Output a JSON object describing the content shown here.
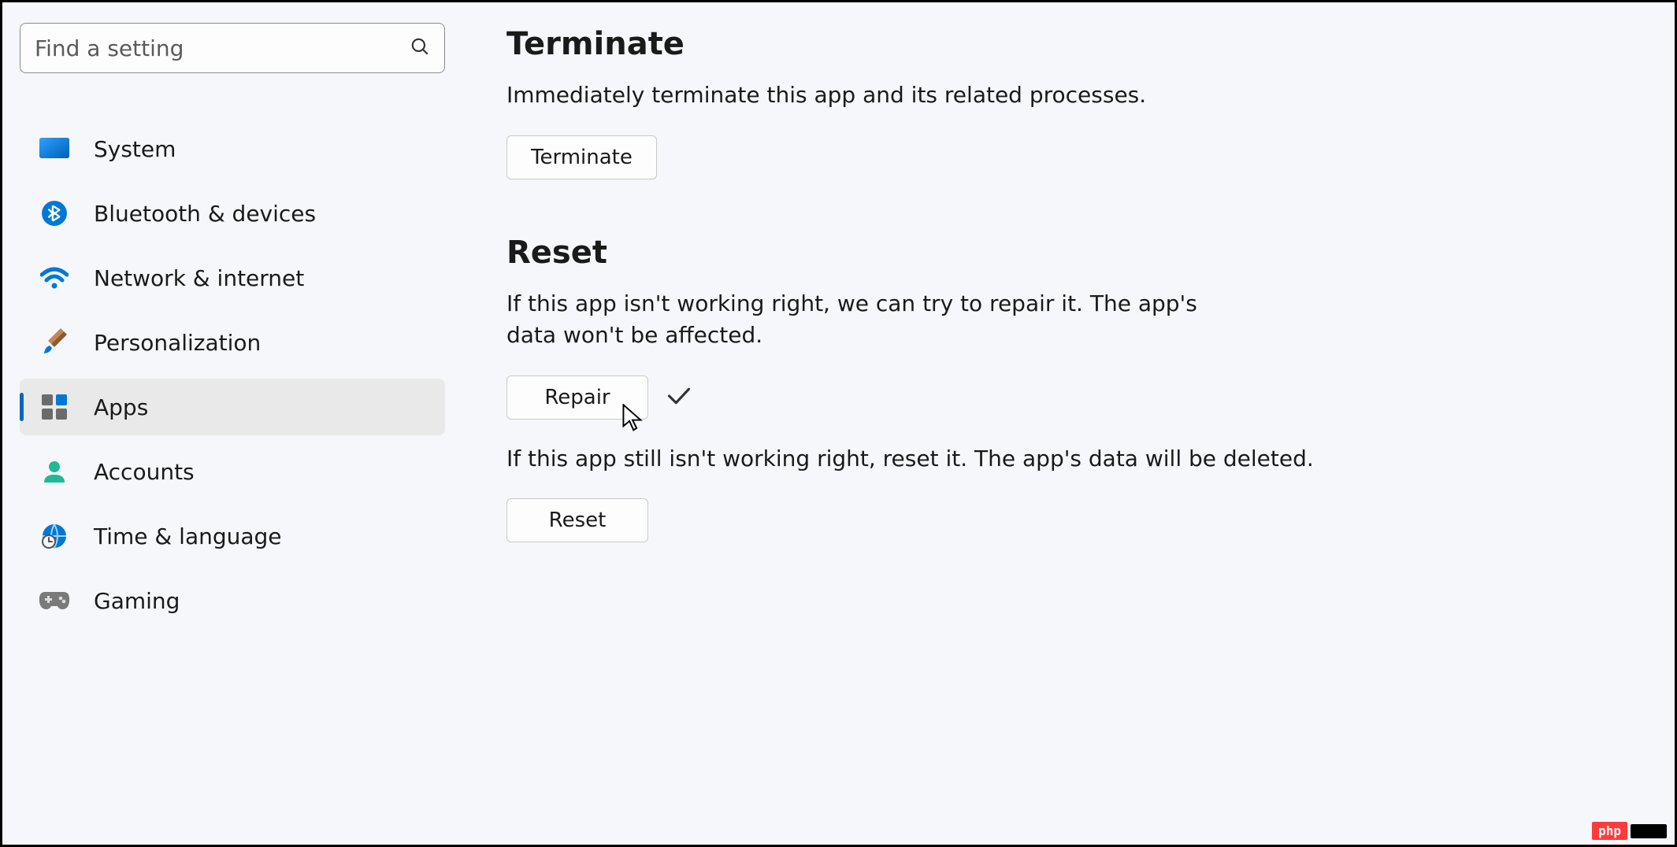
{
  "search": {
    "placeholder": "Find a setting"
  },
  "sidebar": {
    "items": [
      {
        "id": "system",
        "label": "System",
        "icon": "monitor-icon",
        "selected": false
      },
      {
        "id": "bluetooth",
        "label": "Bluetooth & devices",
        "icon": "bluetooth-icon",
        "selected": false
      },
      {
        "id": "network",
        "label": "Network & internet",
        "icon": "wifi-icon",
        "selected": false
      },
      {
        "id": "personalization",
        "label": "Personalization",
        "icon": "brush-icon",
        "selected": false
      },
      {
        "id": "apps",
        "label": "Apps",
        "icon": "apps-icon",
        "selected": true
      },
      {
        "id": "accounts",
        "label": "Accounts",
        "icon": "person-icon",
        "selected": false
      },
      {
        "id": "time",
        "label": "Time & language",
        "icon": "globe-icon",
        "selected": false
      },
      {
        "id": "gaming",
        "label": "Gaming",
        "icon": "gamepad-icon",
        "selected": false
      }
    ]
  },
  "content": {
    "terminate": {
      "heading": "Terminate",
      "description": "Immediately terminate this app and its related processes.",
      "button": "Terminate"
    },
    "reset": {
      "heading": "Reset",
      "repair_description": "If this app isn't working right, we can try to repair it. The app's data won't be affected.",
      "repair_button": "Repair",
      "repair_done": true,
      "reset_description": "If this app still isn't working right, reset it. The app's data will be deleted.",
      "reset_button": "Reset"
    }
  },
  "watermark": {
    "text": "php"
  }
}
